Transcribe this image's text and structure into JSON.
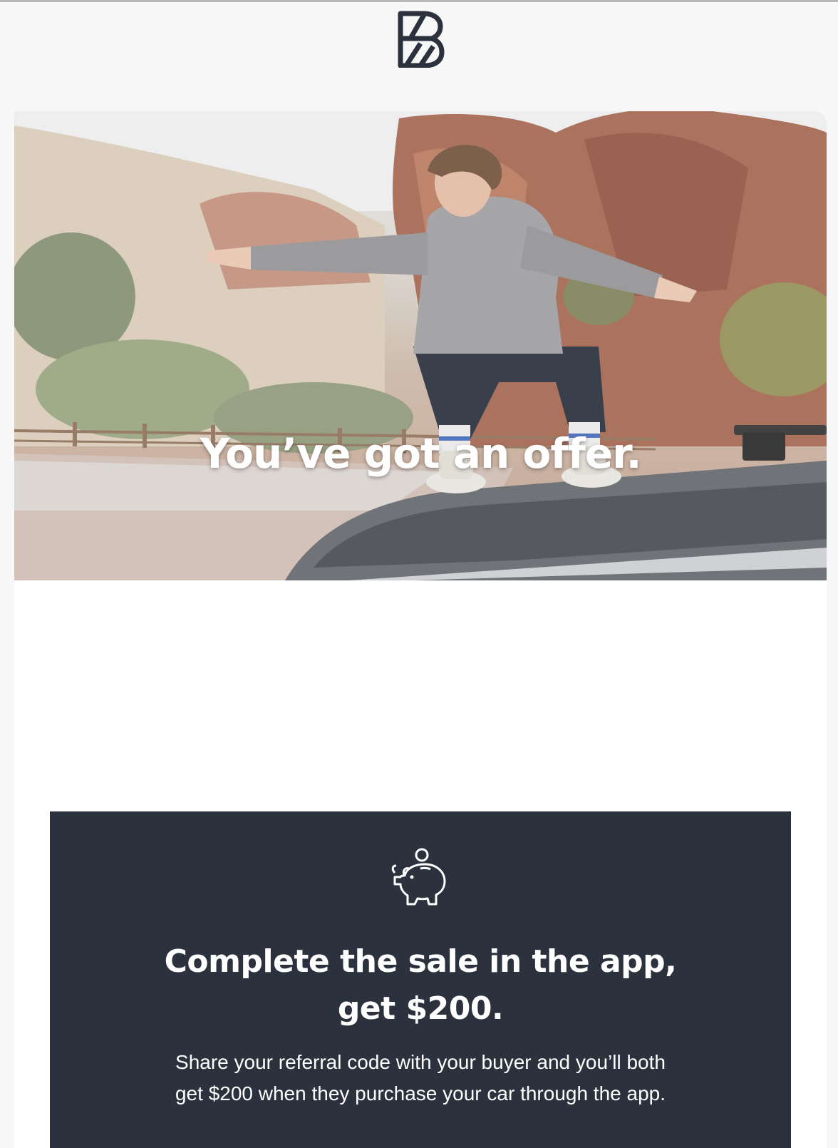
{
  "header": {
    "logo_icon": "brand-b-logo-icon"
  },
  "hero": {
    "title": "You’ve got an offer.",
    "image": "person-surfing-on-car-roof-photo"
  },
  "promo": {
    "icon": "piggy-bank-icon",
    "heading_line1": "Complete the sale in the app,",
    "heading_line2": "get $200.",
    "body_line1": "Share your referral code with your buyer and you’ll both",
    "body_line2": "get $200 when they purchase your car through the app.",
    "background_color": "#2b323d"
  }
}
